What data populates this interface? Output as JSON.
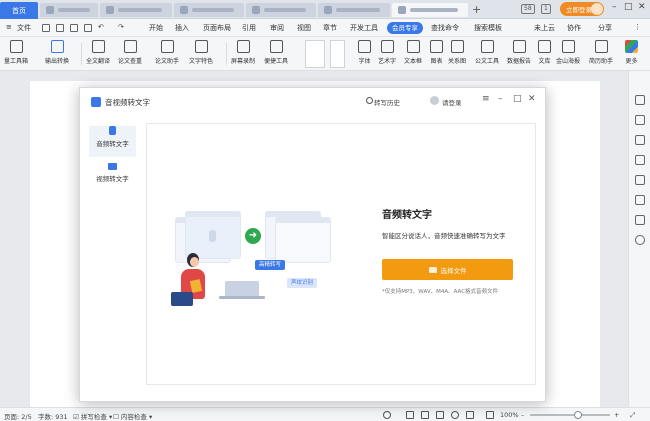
{
  "tabbar": {
    "home": "首页",
    "badges": [
      "58",
      "1"
    ],
    "login": "立即登录"
  },
  "menubar": {
    "file": "文件",
    "items": [
      "开始",
      "插入",
      "页面布局",
      "引用",
      "审阅",
      "视图",
      "章节",
      "开发工具"
    ],
    "vip": "会员专享",
    "search": "查找命令",
    "search_template": "搜索模板",
    "cloud": "未上云",
    "collab": "协作",
    "share": "分享"
  },
  "ribbon": [
    "量工具箱",
    "输出转换",
    "全文翻译",
    "论文查重",
    "论文助手",
    "文字特色",
    "屏幕录制",
    "便捷工具",
    "字体",
    "艺术字",
    "文本框",
    "图表",
    "关系图",
    "公文工具",
    "数据报告",
    "文库",
    "金山海报",
    "简历助手",
    "更多"
  ],
  "modal": {
    "title": "音视频转文字",
    "history": "转写历史",
    "login": "请登录",
    "nav": [
      {
        "label": "音频转文字",
        "active": true
      },
      {
        "label": "视频转文字",
        "active": false
      }
    ],
    "illustration": {
      "tag_highprecision": "高精转写",
      "tag_voiceprint": "声纹识别"
    },
    "heading": "音频转文字",
    "description": "智能区分说话人，音频快速准确转写为文字",
    "button": "选择文件",
    "note": "*仅支持MP3、WAV、M4A、AAC格式音频文件"
  },
  "statusbar": {
    "page": "页面: 2/5",
    "words": "字数: 931",
    "spell": "拼写检查",
    "content": "内容检查",
    "zoom": "100%"
  },
  "colors": {
    "accent": "#3b78e7",
    "button": "#f29a10",
    "login": "#f08a24"
  }
}
